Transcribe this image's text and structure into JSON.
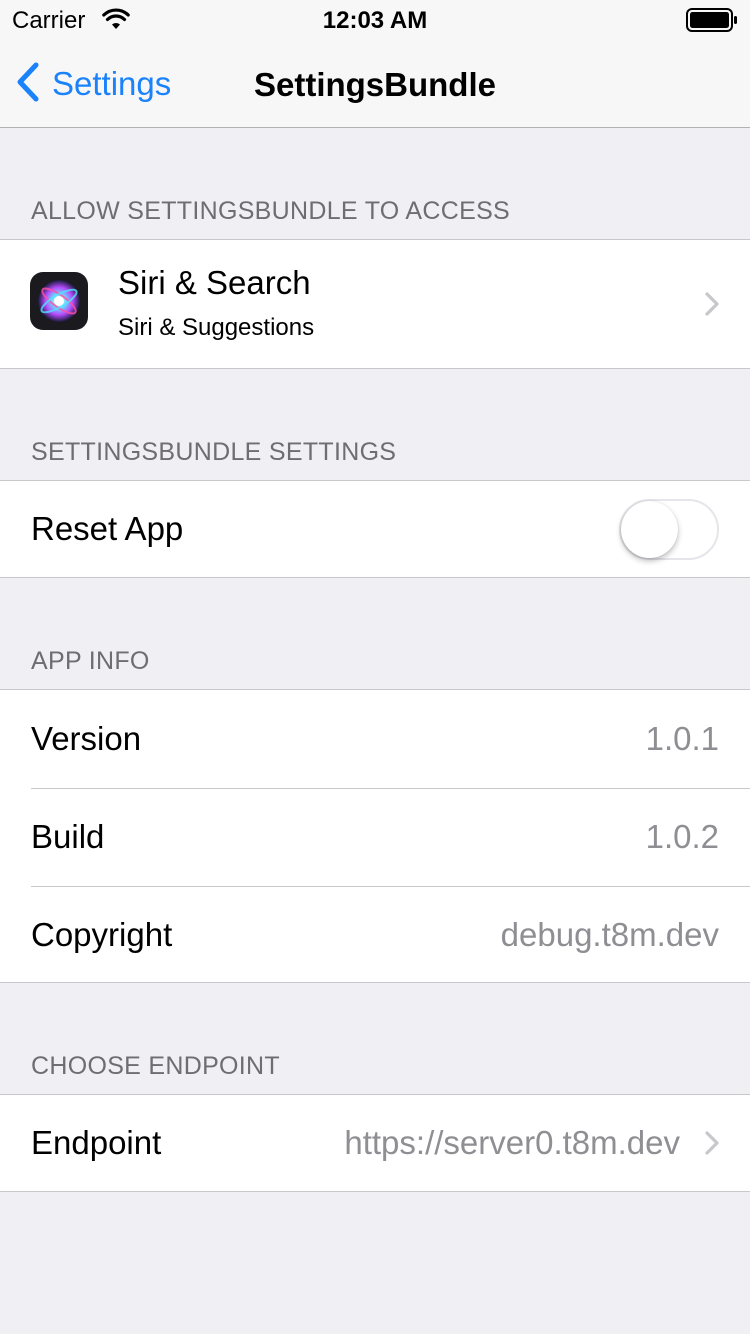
{
  "status": {
    "carrier": "Carrier",
    "time": "12:03 AM",
    "wifi_icon": "wifi-icon",
    "battery_icon": "battery-icon"
  },
  "nav": {
    "back_label": "Settings",
    "title": "SettingsBundle",
    "accent": "#1a82fb"
  },
  "sections": {
    "access": {
      "header": "ALLOW SETTINGSBUNDLE TO ACCESS",
      "siri": {
        "title": "Siri & Search",
        "subtitle": "Siri & Suggestions",
        "icon": "siri-icon"
      }
    },
    "settings": {
      "header": "SETTINGSBUNDLE SETTINGS",
      "reset": {
        "label": "Reset App",
        "on": false
      }
    },
    "info": {
      "header": "APP INFO",
      "rows": [
        {
          "label": "Version",
          "value": "1.0.1"
        },
        {
          "label": "Build",
          "value": "1.0.2"
        },
        {
          "label": "Copyright",
          "value": "debug.t8m.dev"
        }
      ]
    },
    "endpoint": {
      "header": "CHOOSE ENDPOINT",
      "row": {
        "label": "Endpoint",
        "value": "https://server0.t8m.dev"
      }
    }
  }
}
